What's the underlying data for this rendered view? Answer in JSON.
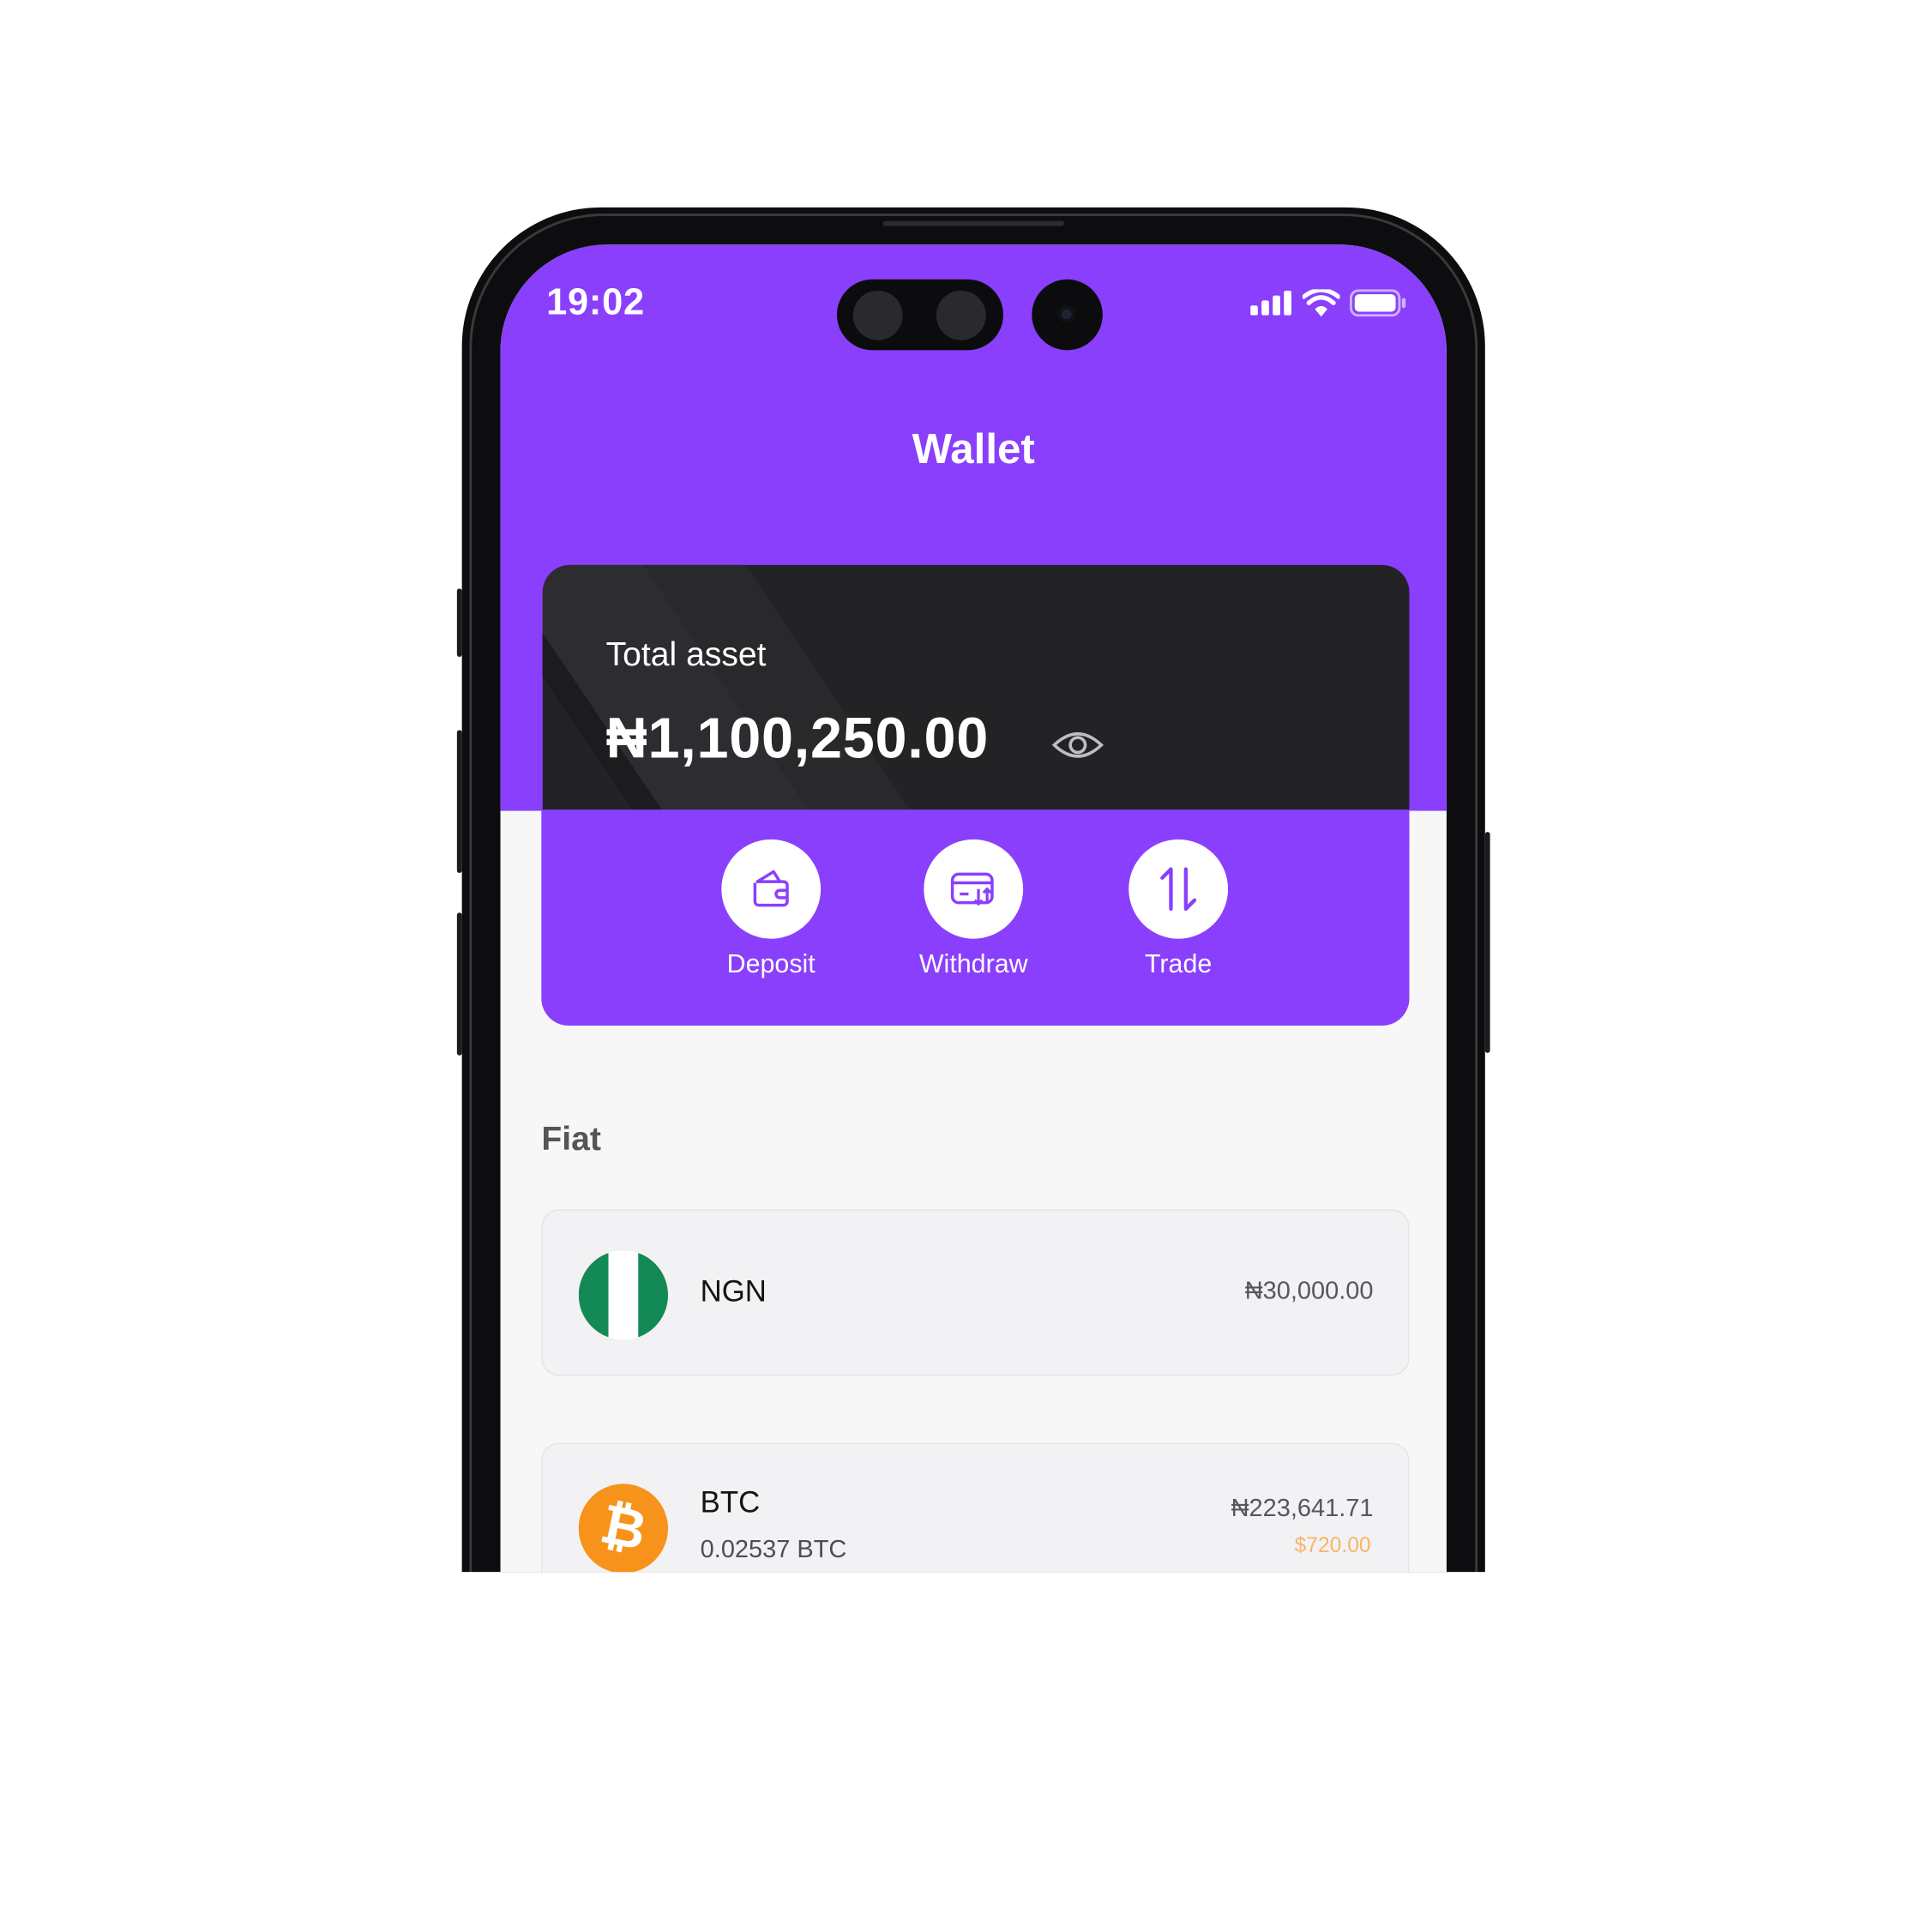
{
  "status_bar": {
    "time": "19:02",
    "icons": [
      "signal-icon",
      "wifi-icon",
      "battery-icon"
    ]
  },
  "header": {
    "title": "Wallet"
  },
  "balance_card": {
    "label": "Total asset",
    "amount": "₦1,100,250.00",
    "visibility_icon": "eye-icon"
  },
  "actions": [
    {
      "label": "Deposit",
      "icon": "wallet-icon"
    },
    {
      "label": "Withdraw",
      "icon": "card-transfer-icon"
    },
    {
      "label": "Trade",
      "icon": "swap-arrows-icon"
    }
  ],
  "fiat_section": {
    "title": "Fiat"
  },
  "assets": [
    {
      "name": "NGN",
      "amount": "₦30,000.00",
      "icon": "nigeria-flag-icon"
    },
    {
      "name": "BTC",
      "holding": "0.02537 BTC",
      "amount": "₦223,641.71",
      "usd_value": "$720.00",
      "icon": "bitcoin-icon"
    }
  ],
  "colors": {
    "brand": "#8a3ffc",
    "card": "#232326",
    "btc": "#f7931a",
    "ngn_green": "#008751",
    "usd_accent": "#f6b56b"
  }
}
